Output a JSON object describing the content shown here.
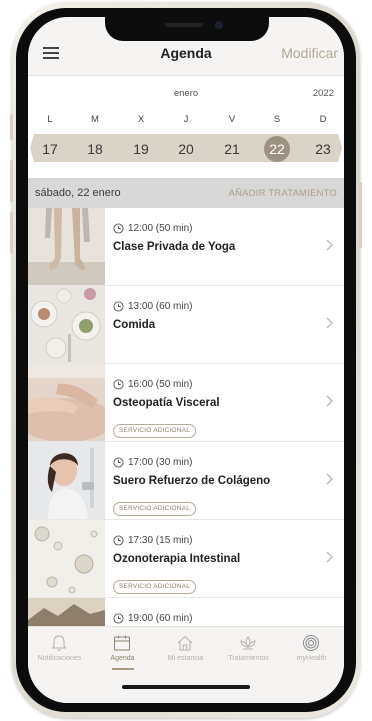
{
  "header": {
    "title": "Agenda",
    "action_label": "Modificar"
  },
  "calendar": {
    "month": "enero",
    "year": "2022",
    "weekdays": [
      "L",
      "M",
      "X",
      "J",
      "V",
      "S",
      "D"
    ],
    "days": [
      "17",
      "18",
      "19",
      "20",
      "21",
      "22",
      "23"
    ],
    "selected_day": "22"
  },
  "date_bar": {
    "date_label": "sábado, 22 enero",
    "add_label": "AÑADIR TRATAMIENTO"
  },
  "appointments": [
    {
      "time": "12:00 (50 min)",
      "title": "Clase Privada de Yoga",
      "badge": ""
    },
    {
      "time": "13:00 (60 min)",
      "title": "Comida",
      "badge": ""
    },
    {
      "time": "16:00 (50 min)",
      "title": "Osteopatía Visceral",
      "badge": "SERVICIO ADICIONAL"
    },
    {
      "time": "17:00 (30 min)",
      "title": "Suero Refuerzo de Colágeno",
      "badge": "SERVICIO ADICIONAL"
    },
    {
      "time": "17:30 (15 min)",
      "title": "Ozonoterapia Intestinal",
      "badge": "SERVICIO ADICIONAL"
    },
    {
      "time": "19:00 (60 min)",
      "title": "",
      "badge": ""
    }
  ],
  "tabbar": {
    "items": [
      {
        "label": "Notificaciones",
        "icon": "bell-icon"
      },
      {
        "label": "Agenda",
        "icon": "calendar-icon"
      },
      {
        "label": "Mi estancia",
        "icon": "house-icon"
      },
      {
        "label": "Tratamientos",
        "icon": "lotus-icon"
      },
      {
        "label": "myHealth",
        "icon": "target-icon"
      }
    ],
    "active": "Agenda"
  },
  "colors": {
    "accent": "#b3a795",
    "selected_day": "#9d9181",
    "strip": "#d9d3c8",
    "date_bar": "#d8d8d8"
  }
}
